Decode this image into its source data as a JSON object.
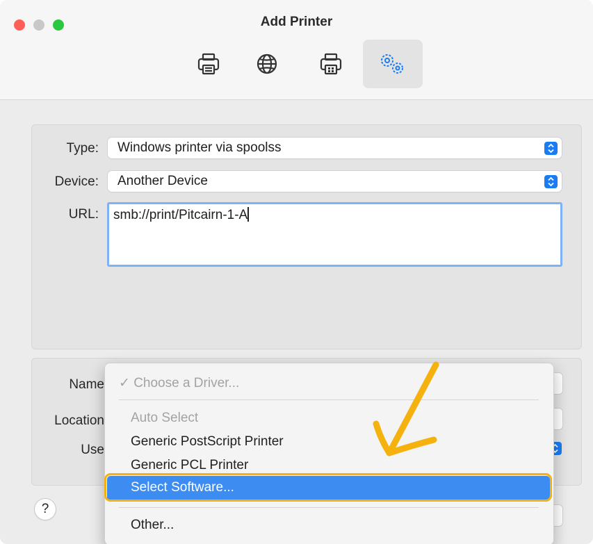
{
  "window": {
    "title": "Add Printer"
  },
  "toolbar": {
    "items": [
      {
        "icon": "printer-icon",
        "selected": false
      },
      {
        "icon": "globe-icon",
        "selected": false
      },
      {
        "icon": "windows-printer-icon",
        "selected": false
      },
      {
        "icon": "gears-icon",
        "selected": true
      }
    ]
  },
  "form": {
    "type_label": "Type:",
    "type_value": "Windows printer via spoolss",
    "device_label": "Device:",
    "device_value": "Another Device",
    "url_label": "URL:",
    "url_value": "smb://print/Pitcairn-1-A",
    "name_label": "Name",
    "location_label": "Location",
    "use_label": "Use"
  },
  "driver_menu": {
    "checked_item": "✓ Choose a Driver...",
    "items": [
      "Auto Select",
      "Generic PostScript Printer",
      "Generic PCL Printer",
      "Select Software...",
      "Other..."
    ],
    "highlighted": "Select Software..."
  },
  "help_label": "?",
  "colors": {
    "accent": "#1a7cf5",
    "highlight": "#3d8cf2",
    "annotation": "#f5b20f"
  }
}
